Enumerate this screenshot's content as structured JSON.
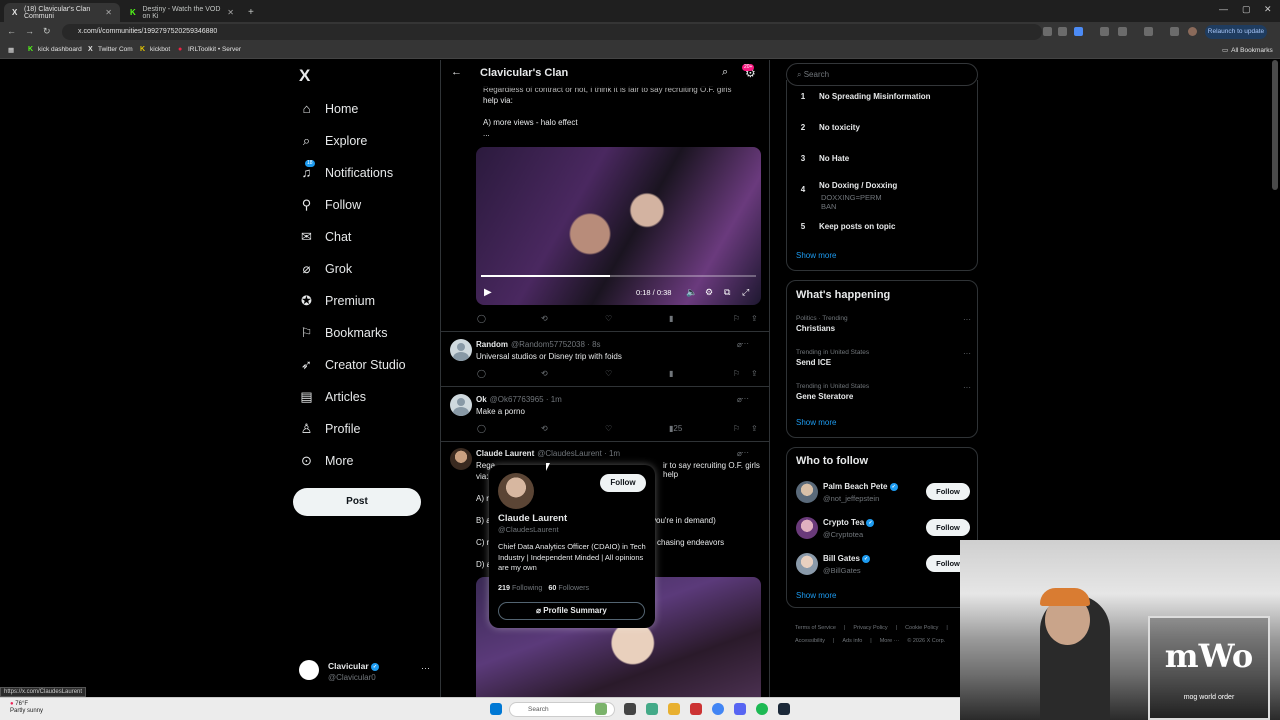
{
  "browser": {
    "tabs": [
      {
        "label": "(18) Clavicular's Clan Communi",
        "active": true
      },
      {
        "label": "Destiny - Watch the VOD on Ki",
        "active": false
      }
    ],
    "new_tab": "+",
    "url": "x.com/i/communities/1992797520259346880",
    "relaunch": "Relaunch to update",
    "bookmarks": [
      "kick dashboard",
      "Twitter Com",
      "kickbot",
      "IRLToolkit • Server"
    ],
    "all_bookmarks": "All Bookmarks",
    "status_url": "https://x.com/ClaudesLaurent"
  },
  "nav": {
    "logo": "X",
    "items": [
      {
        "label": "Home",
        "icon": "home-icon"
      },
      {
        "label": "Explore",
        "icon": "search-icon"
      },
      {
        "label": "Notifications",
        "icon": "bell-icon",
        "badge": "18"
      },
      {
        "label": "Follow",
        "icon": "add-person-icon"
      },
      {
        "label": "Chat",
        "icon": "mail-icon"
      },
      {
        "label": "Grok",
        "icon": "grok-icon"
      },
      {
        "label": "Premium",
        "icon": "premium-icon"
      },
      {
        "label": "Bookmarks",
        "icon": "bookmark-icon"
      },
      {
        "label": "Creator Studio",
        "icon": "rocket-icon"
      },
      {
        "label": "Articles",
        "icon": "article-icon"
      },
      {
        "label": "Profile",
        "icon": "person-icon"
      },
      {
        "label": "More",
        "icon": "more-icon"
      }
    ],
    "post": "Post",
    "account": {
      "name": "Clavicular",
      "handle": "@Clavicular0",
      "more": "···"
    }
  },
  "center": {
    "title": "Clavicular's Clan",
    "back": "←",
    "badge": "20+",
    "top_tweet": {
      "line1": "Regardless of contract or not, I think it is fair to say recruiting O.F. girls",
      "line2": "help via:",
      "line3": "A) more views - halo effect",
      "line4": "...",
      "video_time": "0:18 / 0:38"
    },
    "posts": [
      {
        "name": "Random",
        "handle": "@Random57752038 · 8s",
        "text": "Universal studios or Disney trip with foids",
        "views": ""
      },
      {
        "name": "Ok",
        "handle": "@Ok67763965 · 1m",
        "text": "Make a porno",
        "views": "25"
      }
    ],
    "claude_post": {
      "name": "Claude Laurent",
      "handle": "@ClaudesLaurent · 1m",
      "line1": "Rega",
      "line1_end": "ir to say recruiting O.F. girls help",
      "line2": "via:",
      "a": "A) r",
      "b": "B) a",
      "b_end": "you're in demand)",
      "c": "C) n",
      "c_end": "chasing endeavors",
      "d": "D) a"
    }
  },
  "hovercard": {
    "follow": "Follow",
    "name": "Claude Laurent",
    "handle": "@ClaudesLaurent",
    "bio": "Chief Data Analytics Officer (CDAIO) in Tech Industry | Independent Minded | All opinions are my own",
    "following_count": "219",
    "following_label": "Following",
    "followers_count": "60",
    "followers_label": "Followers",
    "profile_summary": "Profile Summary"
  },
  "right": {
    "search_placeholder": "Search",
    "rules": [
      {
        "num": "1",
        "text": "No Spreading Misinformation"
      },
      {
        "num": "2",
        "text": "No toxicity"
      },
      {
        "num": "3",
        "text": "No Hate"
      },
      {
        "num": "4",
        "text": "No Doxing / Doxxing",
        "sub": "DOXXING=PERM BAN"
      },
      {
        "num": "5",
        "text": "Keep posts on topic"
      }
    ],
    "show_more": "Show more",
    "happening_title": "What's happening",
    "trends": [
      {
        "context": "Politics · Trending",
        "title": "Christians"
      },
      {
        "context": "Trending in United States",
        "title": "Send ICE"
      },
      {
        "context": "Trending in United States",
        "title": "Gene Steratore"
      }
    ],
    "wtf_title": "Who to follow",
    "who_to_follow": [
      {
        "name": "Palm Beach Pete",
        "handle": "@not_jeffepstein",
        "follow": "Follow"
      },
      {
        "name": "Crypto Tea",
        "handle": "@Cryptotea",
        "follow": "Follow"
      },
      {
        "name": "Bill Gates",
        "handle": "@BillGates",
        "follow": "Follow"
      }
    ],
    "footer": [
      "Terms of Service",
      "|",
      "Privacy Policy",
      "|",
      "Cookie Policy",
      "|",
      "Accessibility",
      "|",
      "Ads info",
      "|",
      "More ···",
      "© 2026 X Corp."
    ]
  },
  "webcam": {
    "logo_big": "mWo",
    "logo_small": "mog world order"
  },
  "taskbar": {
    "temp": "76°F",
    "weather": "Partly sunny",
    "search": "Search"
  },
  "colors": {
    "accent": "#1d9bf0",
    "background": "#000000",
    "text": "#e7e9ea",
    "muted": "#71767b"
  }
}
